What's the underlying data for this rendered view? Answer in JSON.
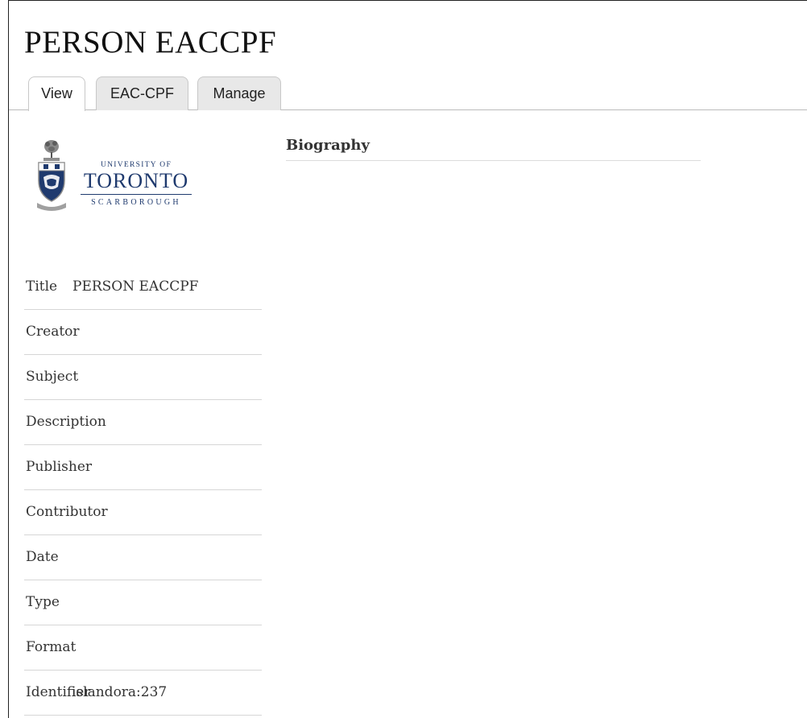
{
  "page": {
    "title": "PERSON EACCPF"
  },
  "tabs": [
    {
      "label": "View",
      "active": true
    },
    {
      "label": "EAC-CPF",
      "active": false
    },
    {
      "label": "Manage",
      "active": false
    }
  ],
  "logo": {
    "line1": "UNIVERSITY OF",
    "line2": "TORONTO",
    "line3": "SCARBOROUGH",
    "color": "#1f3a6e"
  },
  "metadata": {
    "rows": [
      {
        "label": "Title",
        "value": "PERSON EACCPF"
      },
      {
        "label": "Creator",
        "value": ""
      },
      {
        "label": "Subject",
        "value": ""
      },
      {
        "label": "Description",
        "value": ""
      },
      {
        "label": "Publisher",
        "value": ""
      },
      {
        "label": "Contributor",
        "value": ""
      },
      {
        "label": "Date",
        "value": ""
      },
      {
        "label": "Type",
        "value": ""
      },
      {
        "label": "Format",
        "value": ""
      },
      {
        "label": "Identifier",
        "value": "islandora:237"
      }
    ]
  },
  "biography": {
    "heading": "Biography"
  }
}
